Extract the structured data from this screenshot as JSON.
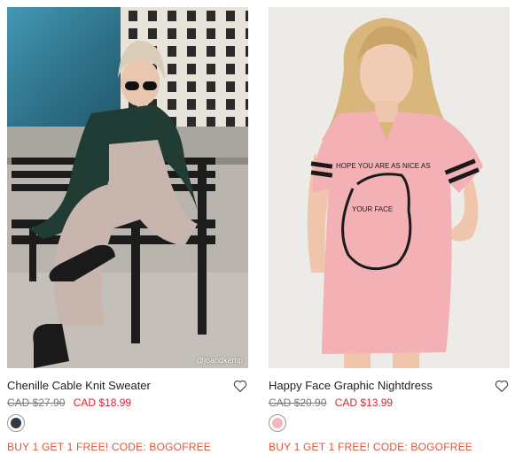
{
  "products": [
    {
      "title": "Chenille Cable Knit Sweater",
      "original_price": "CAD $27.90",
      "sale_price": "CAD $18.99",
      "swatch_color": "#2f3a44",
      "promo": "BUY 1 GET 1 FREE! CODE: BOGOFREE",
      "photo_credit": "@joandkemp",
      "wishlist_icon": "heart-icon"
    },
    {
      "title": "Happy Face Graphic Nightdress",
      "original_price": "CAD $20.90",
      "sale_price": "CAD $13.99",
      "swatch_color": "#f3b7bd",
      "promo": "BUY 1 GET 1 FREE! CODE: BOGOFREE",
      "shirt_text_line1": "HOPE YOU ARE AS NICE AS",
      "shirt_text_line2": "YOUR    FACE",
      "wishlist_icon": "heart-icon"
    }
  ],
  "colors": {
    "sale_red": "#d9252f",
    "promo_orange": "#d9573a",
    "strike_gray": "#777777"
  }
}
